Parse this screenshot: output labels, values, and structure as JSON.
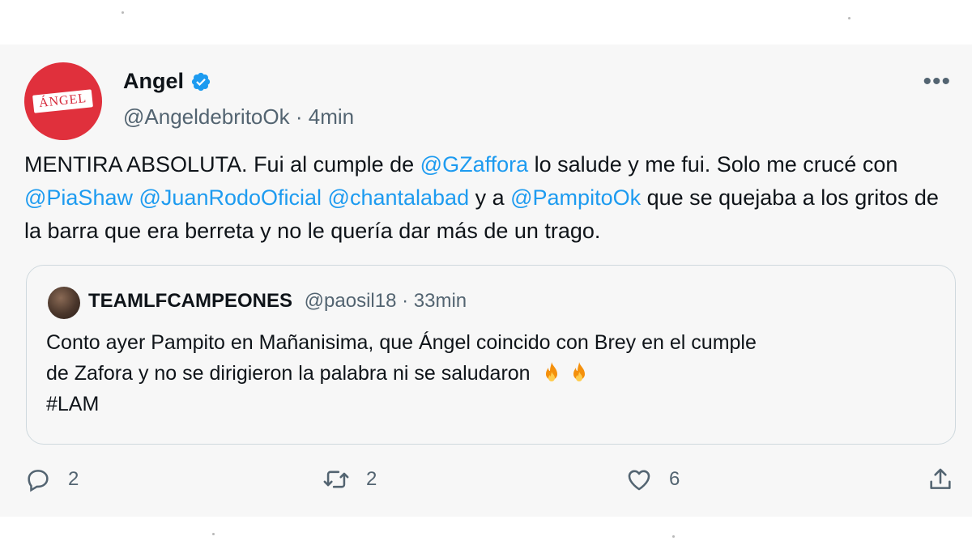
{
  "tweet": {
    "author_name": "Angel",
    "avatar_text": "ÁNGEL",
    "handle": "@AngeldebritoOk",
    "separator": " · ",
    "time": "4min",
    "text_parts": [
      {
        "text": "MENTIRA ABSOLUTA. Fui al cumple de ",
        "type": "text"
      },
      {
        "text": "@GZaffora",
        "type": "mention"
      },
      {
        "text": " lo salude y me fui. Solo me crucé con ",
        "type": "text"
      },
      {
        "text": "@PiaShaw",
        "type": "mention"
      },
      {
        "text": " ",
        "type": "text"
      },
      {
        "text": "@JuanRodoOficial",
        "type": "mention"
      },
      {
        "text": " ",
        "type": "text"
      },
      {
        "text": "@chantalabad",
        "type": "mention"
      },
      {
        "text": " y a ",
        "type": "text"
      },
      {
        "text": "@PampitoOk",
        "type": "mention"
      },
      {
        "text": " que se quejaba a los gritos de la barra que era berreta y no le quería dar más de un trago.",
        "type": "text"
      }
    ]
  },
  "quoted": {
    "author_name": "TEAMLFCAMPEONES",
    "handle": "@paosil18",
    "separator": " · ",
    "time": "33min",
    "line1": "Conto ayer Pampito en Mañanisima, que Ángel coincido con Brey en el cumple",
    "line2": "de Zafora y no se dirigieron la palabra ni se saludaron",
    "hashtag": "#LAM"
  },
  "actions": {
    "reply_count": "2",
    "retweet_count": "2",
    "like_count": "6"
  },
  "colors": {
    "mention": "#1d9bf0",
    "secondary_text": "#536471",
    "avatar_bg": "#e0303c",
    "card_bg": "#f7f7f7"
  },
  "icons": [
    "verified-icon",
    "more-icon",
    "reply-icon",
    "retweet-icon",
    "like-icon",
    "share-icon",
    "fire-icon"
  ]
}
